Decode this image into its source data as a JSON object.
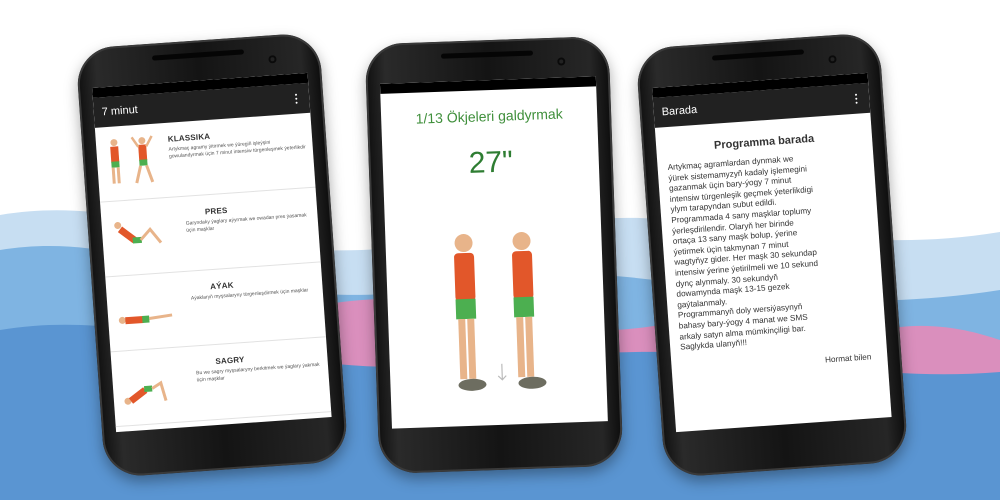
{
  "colors": {
    "appbar": "#212121",
    "accent_green": "#3f8f3b",
    "wave_blue": "#4a90d9",
    "wave_light": "#bcd8f0",
    "wave_pink": "#e48bb9"
  },
  "screen1": {
    "title": "7 minut",
    "items": [
      {
        "title": "KLASSIKA",
        "desc": "Artykmaç agramy ýitirmek we ýüregiň işleýşini gowulandyrmak üçin 7 minut intensiw türgenleşmek ýeterlikdir"
      },
      {
        "title": "PRES",
        "desc": "Garyndaky ýaglary aýyrmak we owadan pres ýasamak üçin maşklar"
      },
      {
        "title": "AÝAK",
        "desc": "Aýaklaryň myşsalaryny türgenleşdirmek üçin maşklar"
      },
      {
        "title": "SAGRY",
        "desc": "Bu we sagry myşsalaryny berkitmek we ýaglary ýakmak üçin maşklar"
      }
    ]
  },
  "screen2": {
    "title": "1/13 Ökjeleri galdyrmak",
    "timer": "27\""
  },
  "screen3": {
    "appbar_title": "Barada",
    "heading": "Programma barada",
    "lines": [
      "Artykmaç agramlardan dynmak we",
      "ýürek sistemamyzyň kadaly işlemegini",
      "gazanmak üçin bary-ýogy 7 minut",
      "intensiw türgenleşik geçmek ýeterlikdigi",
      "ylym tarapyndan subut edildi.",
      "Programmada 4 sany maşklar toplumy",
      "ýerleşdirilendir. Olaryň her birinde",
      "ortaça 13 sany maşk bolup, ýerine",
      "ýetirmek üçin takmynan 7 minut",
      "wagtyňyz gider. Her maşk 30 sekundap",
      "intensiw ýerine ýetirilmeli we 10 sekund",
      "dynç alynmaly. 30 sekundyň",
      "dowamynda maşk 13-15 gezek",
      "gaýtalanmaly.",
      "Programmanyň doly wersiýasynyň",
      "bahasy bary-ýogy 4 manat we SMS",
      "arkaly satyn alma mümkinçiligi bar.",
      "Saglykda ulanyň!!!"
    ],
    "signoff": "Hormat bilen"
  }
}
